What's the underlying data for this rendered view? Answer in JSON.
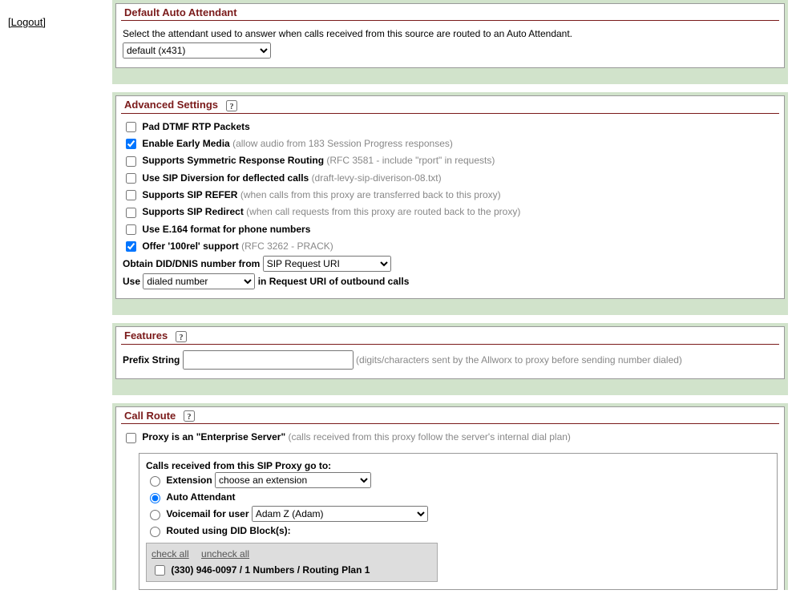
{
  "nav": {
    "logout": "[Logout]"
  },
  "defaultAA": {
    "title": "Default Auto Attendant",
    "desc": "Select the attendant used to answer when calls received from this source are routed to an Auto Attendant.",
    "selected": "default (x431)"
  },
  "advanced": {
    "title": "Advanced Settings",
    "padDtmf": {
      "label": "Pad DTMF RTP Packets",
      "checked": false
    },
    "earlyMedia": {
      "label": "Enable Early Media",
      "hint": "(allow audio from 183 Session Progress responses)",
      "checked": true
    },
    "symResp": {
      "label": "Supports Symmetric Response Routing",
      "hint": "(RFC 3581 - include \"rport\" in requests)",
      "checked": false
    },
    "sipDiversion": {
      "label": "Use SIP Diversion for deflected calls",
      "hint": "(draft-levy-sip-diverison-08.txt)",
      "checked": false
    },
    "sipRefer": {
      "label": "Supports SIP REFER",
      "hint": "(when calls from this proxy are transferred back to this proxy)",
      "checked": false
    },
    "sipRedirect": {
      "label": "Supports SIP Redirect",
      "hint": "(when call requests from this proxy are routed back to the proxy)",
      "checked": false
    },
    "e164": {
      "label": "Use E.164 format for phone numbers",
      "checked": false
    },
    "rel100": {
      "label": "Offer '100rel' support",
      "hint": "(RFC 3262 - PRACK)",
      "checked": true
    },
    "obtainDid": {
      "label": "Obtain DID/DNIS number from",
      "selected": "SIP Request URI"
    },
    "useDialed": {
      "prefix": "Use",
      "selected": "dialed number",
      "suffix": "in Request URI of outbound calls"
    }
  },
  "features": {
    "title": "Features",
    "prefixLabel": "Prefix String",
    "prefixValue": "",
    "prefixHint": "(digits/characters sent by the Allworx to proxy before sending number dialed)"
  },
  "callRoute": {
    "title": "Call Route",
    "enterprise": {
      "label": "Proxy is an \"Enterprise Server\"",
      "hint": "(calls received from this proxy follow the server's internal dial plan)",
      "checked": false
    },
    "header": "Calls received from this SIP Proxy go to:",
    "ext": {
      "label": "Extension",
      "selected": "choose an extension"
    },
    "aa": {
      "label": "Auto Attendant"
    },
    "vm": {
      "label": "Voicemail for user",
      "selected": "Adam Z (Adam)"
    },
    "did": {
      "label": "Routed using DID Block(s):",
      "checkAll": "check all",
      "uncheckAll": "uncheck all",
      "item": "(330) 946-0097 / 1 Numbers / Routing Plan 1"
    }
  }
}
